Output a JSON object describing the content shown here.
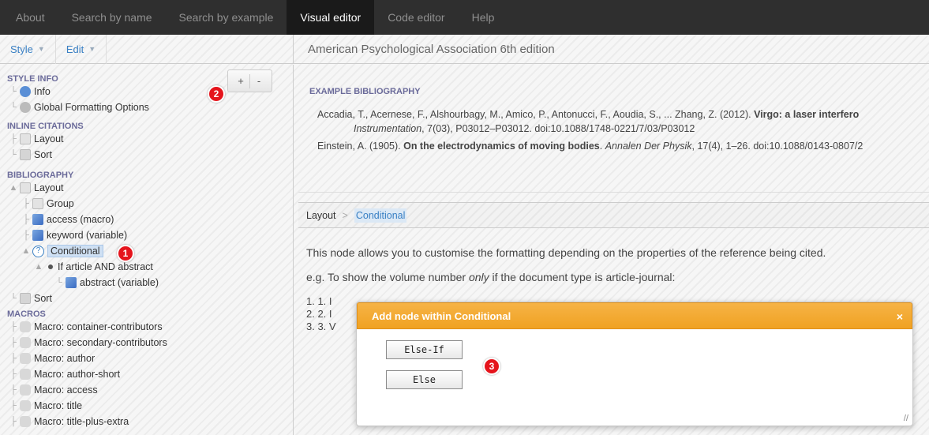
{
  "topnav": {
    "tabs": [
      "About",
      "Search by name",
      "Search by example",
      "Visual editor",
      "Code editor",
      "Help"
    ],
    "active": "Visual editor"
  },
  "menubar": {
    "style_label": "Style",
    "edit_label": "Edit"
  },
  "style_title": "American Psychological Association 6th edition",
  "tree": {
    "style_info_title": "STYLE INFO",
    "info_label": "Info",
    "global_formatting_label": "Global Formatting Options",
    "inline_citations_title": "INLINE CITATIONS",
    "inline_layout_label": "Layout",
    "inline_sort_label": "Sort",
    "bibliography_title": "BIBLIOGRAPHY",
    "bib_layout_label": "Layout",
    "group_label": "Group",
    "access_macro_label": "access (macro)",
    "keyword_label": "keyword (variable)",
    "conditional_label": "Conditional",
    "if_label": "If article AND abstract",
    "abstract_label": "abstract (variable)",
    "bib_sort_label": "Sort",
    "macros_title": "MACROS",
    "macros": [
      "Macro: container-contributors",
      "Macro: secondary-contributors",
      "Macro: author",
      "Macro: author-short",
      "Macro: access",
      "Macro: title",
      "Macro: title-plus-extra"
    ]
  },
  "pm": {
    "plus": "+",
    "minus": "-"
  },
  "badges": {
    "b1": "1",
    "b2": "2",
    "b3": "3"
  },
  "example": {
    "title": "EXAMPLE BIBLIOGRAPHY",
    "entry1_pre": "Accadia, T., Acernese, F., Alshourbagy, M., Amico, P., Antonucci, F., Aoudia, S., ... Zhang, Z. (2012). ",
    "entry1_bold": "Virgo: a laser interfero",
    "entry1_journal": "Instrumentation",
    "entry1_rest": ", 7(03), P03012–P03012. doi:10.1088/1748-0221/7/03/P03012",
    "entry2_pre": "Einstein, A. (1905). ",
    "entry2_bold": "On the electrodynamics of moving bodies",
    "entry2_mid": ". ",
    "entry2_journal": "Annalen Der Physik",
    "entry2_rest": ", 17(4), 1–26. doi:10.1088/0143-0807/2"
  },
  "breadcrumb": {
    "parent": "Layout",
    "sep": ">",
    "current": "Conditional"
  },
  "description": {
    "p1": "This node allows you to customise the formatting depending on the properties of the reference being cited.",
    "p2_pre": "e.g. To show the volume number ",
    "p2_em": "only",
    "p2_post": " if the document type is article-journal:",
    "items": [
      "1. 1. I",
      "2. 2. I",
      "3. 3. V"
    ]
  },
  "dialog": {
    "title": "Add node within Conditional",
    "close": "×",
    "else_if_label": "Else-If",
    "else_label": "Else"
  },
  "colors": {
    "accent": "#3a80c4",
    "dialog_header": "#f0a222",
    "badge": "#e5141c",
    "topnav": "#2f2f2f"
  }
}
